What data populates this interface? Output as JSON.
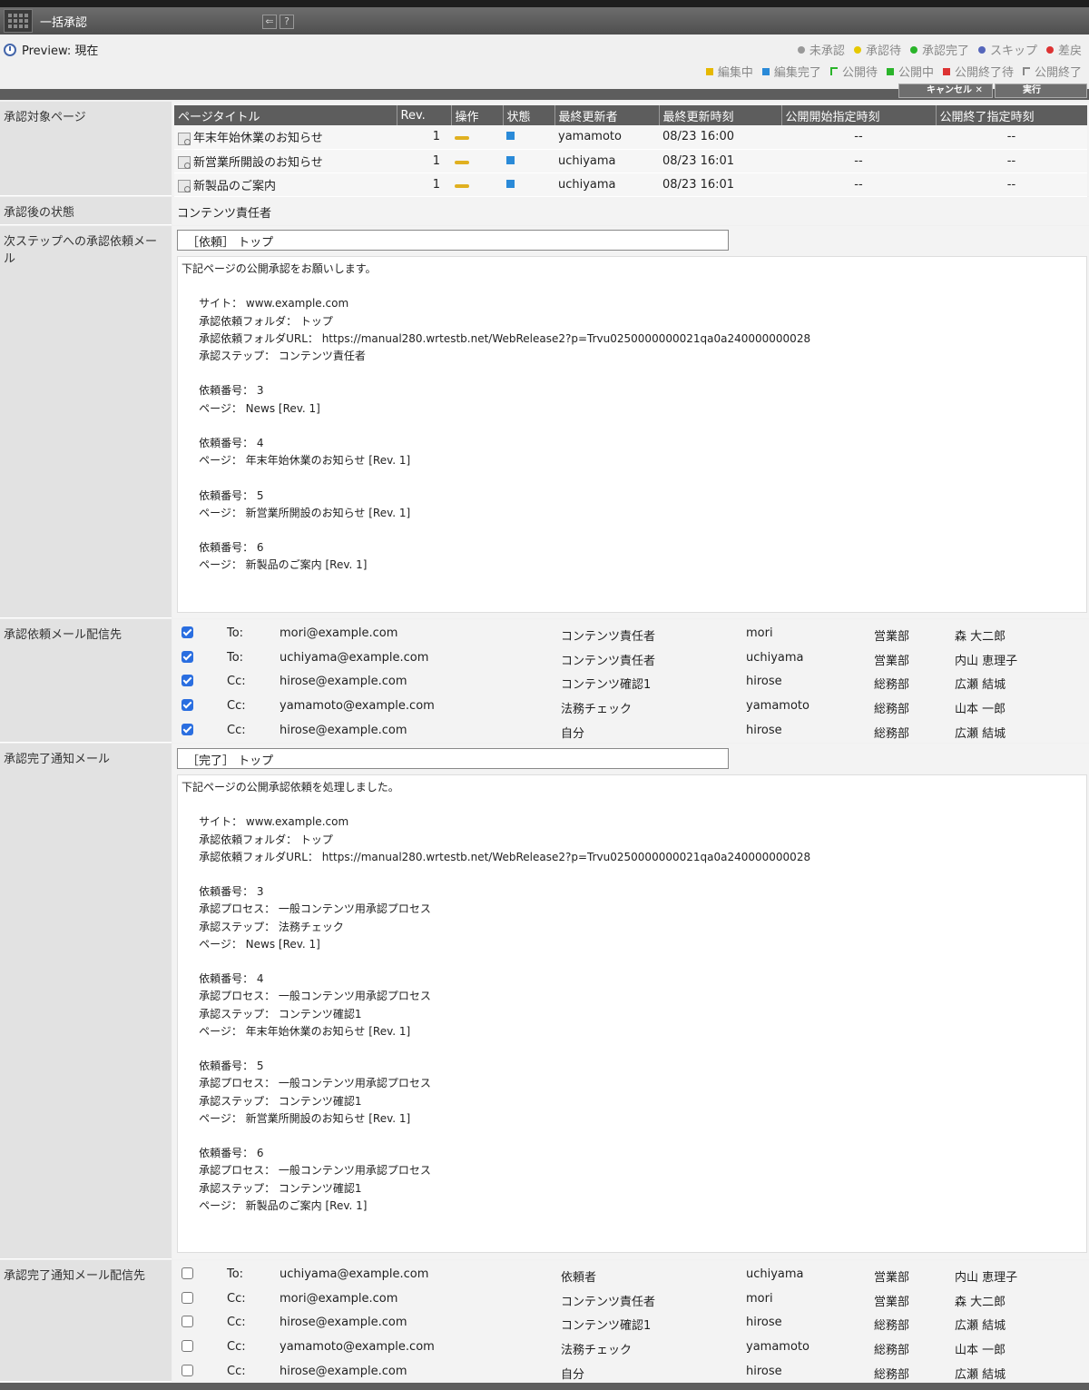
{
  "window": {
    "title": "一括承認"
  },
  "preview": {
    "label": "Preview: 現在"
  },
  "legend_status": [
    {
      "label": "未承認",
      "color": "#999999"
    },
    {
      "label": "承認待",
      "color": "#e6c800"
    },
    {
      "label": "承認完了",
      "color": "#2ab42a"
    },
    {
      "label": "スキップ",
      "color": "#5566bb"
    },
    {
      "label": "差戻",
      "color": "#dd3333"
    }
  ],
  "legend_publish": [
    {
      "label": "編集中",
      "color": "#e6b800",
      "shape": "sq"
    },
    {
      "label": "編集完了",
      "color": "#2a8ad8",
      "shape": "sq"
    },
    {
      "label": "公開待",
      "color": "#2ab42a",
      "shape": "flag"
    },
    {
      "label": "公開中",
      "color": "#2ab42a",
      "shape": "sq"
    },
    {
      "label": "公開終了待",
      "color": "#dd3333",
      "shape": "sq"
    },
    {
      "label": "公開終了",
      "color": "#888888",
      "shape": "flag"
    }
  ],
  "actions": {
    "cancel": "キャンセル",
    "execute": "実行"
  },
  "labels": {
    "target_pages": "承認対象ページ",
    "after_state": "承認後の状態",
    "request_mail": "次ステップへの承認依頼メール",
    "request_recipients": "承認依頼メール配信先",
    "complete_mail": "承認完了通知メール",
    "complete_recipients": "承認完了通知メール配信先"
  },
  "pages_table": {
    "headers": [
      "ページタイトル",
      "Rev.",
      "操作",
      "状態",
      "最終更新者",
      "最終更新時刻",
      "公開開始指定時刻",
      "公開終了指定時刻"
    ],
    "rows": [
      {
        "title": "年末年始休業のお知らせ",
        "rev": "1",
        "updater": "yamamoto",
        "updated": "08/23 16:00",
        "start": "--",
        "end": "--"
      },
      {
        "title": "新営業所開設のお知らせ",
        "rev": "1",
        "updater": "uchiyama",
        "updated": "08/23 16:01",
        "start": "--",
        "end": "--"
      },
      {
        "title": "新製品のご案内",
        "rev": "1",
        "updater": "uchiyama",
        "updated": "08/23 16:01",
        "start": "--",
        "end": "--"
      }
    ]
  },
  "after_state": "コンテンツ責任者",
  "request_mail": {
    "subject": "［依頼］ トップ",
    "body": "下記ページの公開承認をお願いします。\n\n     サイト： www.example.com\n     承認依頼フォルダ： トップ\n     承認依頼フォルダURL： https://manual280.wrtestb.net/WebRelease2?p=Trvu0250000000021qa0a240000000028\n     承認ステップ： コンテンツ責任者\n\n     依頼番号： 3\n     ページ： News [Rev. 1]\n\n     依頼番号： 4\n     ページ： 年末年始休業のお知らせ [Rev. 1]\n\n     依頼番号： 5\n     ページ： 新営業所開設のお知らせ [Rev. 1]\n\n     依頼番号： 6\n     ページ： 新製品のご案内 [Rev. 1]"
  },
  "request_recipients": [
    {
      "checked": true,
      "type": "To:",
      "email": "mori@example.com",
      "role": "コンテンツ責任者",
      "user": "mori",
      "dept": "営業部",
      "name": "森 大二郎"
    },
    {
      "checked": true,
      "type": "To:",
      "email": "uchiyama@example.com",
      "role": "コンテンツ責任者",
      "user": "uchiyama",
      "dept": "営業部",
      "name": "内山 恵理子"
    },
    {
      "checked": true,
      "type": "Cc:",
      "email": "hirose@example.com",
      "role": "コンテンツ確認1",
      "user": "hirose",
      "dept": "総務部",
      "name": "広瀬 結城"
    },
    {
      "checked": true,
      "type": "Cc:",
      "email": "yamamoto@example.com",
      "role": "法務チェック",
      "user": "yamamoto",
      "dept": "総務部",
      "name": "山本 一郎"
    },
    {
      "checked": true,
      "type": "Cc:",
      "email": "hirose@example.com",
      "role": "自分",
      "user": "hirose",
      "dept": "総務部",
      "name": "広瀬 結城"
    }
  ],
  "complete_mail": {
    "subject": "［完了］ トップ",
    "body": "下記ページの公開承認依頼を処理しました。\n\n     サイト： www.example.com\n     承認依頼フォルダ： トップ\n     承認依頼フォルダURL： https://manual280.wrtestb.net/WebRelease2?p=Trvu0250000000021qa0a240000000028\n\n     依頼番号： 3\n     承認プロセス： 一般コンテンツ用承認プロセス\n     承認ステップ： 法務チェック\n     ページ： News [Rev. 1]\n\n     依頼番号： 4\n     承認プロセス： 一般コンテンツ用承認プロセス\n     承認ステップ： コンテンツ確認1\n     ページ： 年末年始休業のお知らせ [Rev. 1]\n\n     依頼番号： 5\n     承認プロセス： 一般コンテンツ用承認プロセス\n     承認ステップ： コンテンツ確認1\n     ページ： 新営業所開設のお知らせ [Rev. 1]\n\n     依頼番号： 6\n     承認プロセス： 一般コンテンツ用承認プロセス\n     承認ステップ： コンテンツ確認1\n     ページ： 新製品のご案内 [Rev. 1]"
  },
  "complete_recipients": [
    {
      "checked": false,
      "type": "To:",
      "email": "uchiyama@example.com",
      "role": "依頼者",
      "user": "uchiyama",
      "dept": "営業部",
      "name": "内山 恵理子"
    },
    {
      "checked": false,
      "type": "Cc:",
      "email": "mori@example.com",
      "role": "コンテンツ責任者",
      "user": "mori",
      "dept": "営業部",
      "name": "森 大二郎"
    },
    {
      "checked": false,
      "type": "Cc:",
      "email": "hirose@example.com",
      "role": "コンテンツ確認1",
      "user": "hirose",
      "dept": "総務部",
      "name": "広瀬 結城"
    },
    {
      "checked": false,
      "type": "Cc:",
      "email": "yamamoto@example.com",
      "role": "法務チェック",
      "user": "yamamoto",
      "dept": "総務部",
      "name": "山本 一郎"
    },
    {
      "checked": false,
      "type": "Cc:",
      "email": "hirose@example.com",
      "role": "自分",
      "user": "hirose",
      "dept": "総務部",
      "name": "広瀬 結城"
    }
  ]
}
